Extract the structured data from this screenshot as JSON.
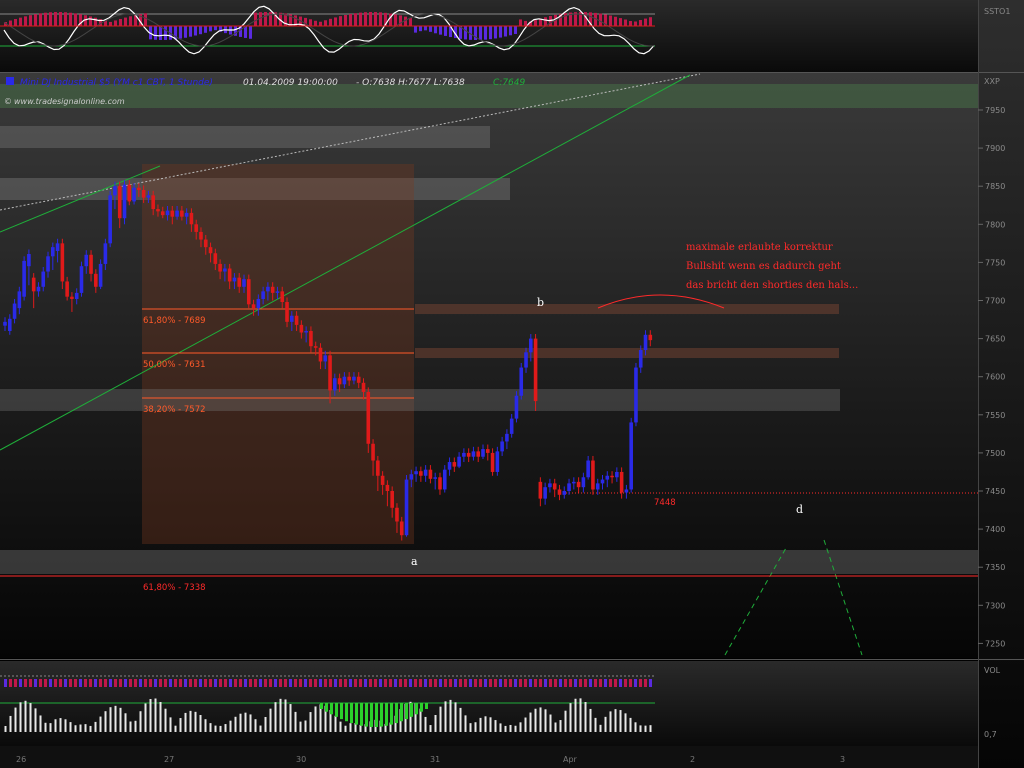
{
  "colors": {
    "bull": "#2a2ae8",
    "bear": "#e01a1a",
    "fib": "#ff5a2a",
    "annot": "#ff2a2a",
    "trend": "#1fae3a",
    "text": "#dddddd"
  },
  "header": {
    "title": "Mini DJ Industrial $5 (YM c1 CBT, 1 Stunde)",
    "datetime": "01.04.2009 19:00:00",
    "values": "- O:7638 H:7677 L:7638",
    "close": "C:7649",
    "website": "www.tradesignalonline.com"
  },
  "indicator_top": {
    "label": "SSTO1"
  },
  "indicator_bottom": {
    "label": "VOL",
    "ticks": [
      "0,7"
    ]
  },
  "price_axis": {
    "label": "XXP",
    "ticks": [
      "7950",
      "7900",
      "7850",
      "7800",
      "7750",
      "7700",
      "7650",
      "7600",
      "7550",
      "7500",
      "7450",
      "7400",
      "7350",
      "7300",
      "7250"
    ]
  },
  "chart_data": {
    "type": "candlestick",
    "x_ticks": [
      "26",
      "27",
      "30",
      "31",
      "Apr",
      "2",
      "3"
    ],
    "ylim": [
      7225,
      7975
    ],
    "candles": [
      [
        0,
        7667,
        7672,
        7660
      ],
      [
        1,
        7660,
        7676,
        7655
      ],
      [
        2,
        7676,
        7696,
        7670
      ],
      [
        3,
        7690,
        7712,
        7682
      ],
      [
        4,
        7705,
        7752,
        7700
      ],
      [
        5,
        7745,
        7761,
        7720
      ],
      [
        6,
        7730,
        7712,
        7690
      ],
      [
        7,
        7712,
        7718,
        7705
      ],
      [
        8,
        7718,
        7738,
        7712
      ],
      [
        9,
        7738,
        7758,
        7730
      ],
      [
        10,
        7758,
        7770,
        7740
      ],
      [
        11,
        7765,
        7775,
        7750
      ],
      [
        12,
        7775,
        7725,
        7715
      ],
      [
        13,
        7725,
        7705,
        7700
      ],
      [
        14,
        7705,
        7702,
        7685
      ],
      [
        15,
        7702,
        7710,
        7695
      ],
      [
        16,
        7710,
        7745,
        7705
      ],
      [
        17,
        7745,
        7760,
        7735
      ],
      [
        18,
        7760,
        7735,
        7725
      ],
      [
        19,
        7735,
        7718,
        7710
      ],
      [
        20,
        7718,
        7748,
        7715
      ],
      [
        21,
        7748,
        7775,
        7740
      ],
      [
        22,
        7775,
        7838,
        7770
      ],
      [
        23,
        7838,
        7850,
        7820
      ],
      [
        24,
        7850,
        7808,
        7795
      ],
      [
        25,
        7808,
        7852,
        7800
      ],
      [
        26,
        7852,
        7830,
        7825
      ],
      [
        27,
        7830,
        7848,
        7826
      ],
      [
        28,
        7848,
        7845,
        7836
      ],
      [
        29,
        7845,
        7835,
        7828
      ],
      [
        30,
        7835,
        7838,
        7828
      ],
      [
        31,
        7838,
        7820,
        7812
      ],
      [
        32,
        7820,
        7817,
        7810
      ],
      [
        33,
        7817,
        7812,
        7808
      ],
      [
        34,
        7812,
        7818,
        7805
      ],
      [
        35,
        7818,
        7810,
        7800
      ],
      [
        36,
        7810,
        7818,
        7806
      ],
      [
        37,
        7818,
        7810,
        7805
      ],
      [
        38,
        7810,
        7815,
        7800
      ],
      [
        39,
        7815,
        7800,
        7790
      ],
      [
        40,
        7800,
        7790,
        7780
      ],
      [
        41,
        7790,
        7780,
        7770
      ],
      [
        42,
        7780,
        7770,
        7760
      ],
      [
        43,
        7770,
        7762,
        7750
      ],
      [
        44,
        7762,
        7748,
        7740
      ],
      [
        45,
        7748,
        7738,
        7728
      ],
      [
        46,
        7738,
        7742,
        7725
      ],
      [
        47,
        7742,
        7725,
        7715
      ],
      [
        48,
        7725,
        7730,
        7715
      ],
      [
        49,
        7730,
        7718,
        7710
      ],
      [
        50,
        7718,
        7728,
        7710
      ],
      [
        51,
        7728,
        7695,
        7690
      ],
      [
        52,
        7695,
        7690,
        7680
      ],
      [
        53,
        7690,
        7702,
        7680
      ],
      [
        54,
        7702,
        7712,
        7695
      ],
      [
        55,
        7712,
        7718,
        7700
      ],
      [
        56,
        7718,
        7710,
        7700
      ],
      [
        57,
        7710,
        7712,
        7702
      ],
      [
        58,
        7712,
        7698,
        7690
      ],
      [
        59,
        7698,
        7672,
        7665
      ],
      [
        60,
        7672,
        7680,
        7660
      ],
      [
        61,
        7680,
        7668,
        7660
      ],
      [
        62,
        7668,
        7658,
        7650
      ],
      [
        63,
        7658,
        7660,
        7645
      ],
      [
        64,
        7660,
        7640,
        7632
      ],
      [
        65,
        7640,
        7638,
        7628
      ],
      [
        66,
        7638,
        7620,
        7610
      ],
      [
        67,
        7620,
        7628,
        7610
      ],
      [
        68,
        7628,
        7582,
        7565
      ],
      [
        69,
        7582,
        7598,
        7575
      ],
      [
        70,
        7598,
        7590,
        7580
      ],
      [
        71,
        7590,
        7600,
        7585
      ],
      [
        72,
        7600,
        7595,
        7588
      ],
      [
        73,
        7595,
        7600,
        7590
      ],
      [
        74,
        7600,
        7592,
        7585
      ],
      [
        75,
        7592,
        7580,
        7570
      ],
      [
        76,
        7580,
        7512,
        7500
      ],
      [
        77,
        7512,
        7490,
        7470
      ],
      [
        78,
        7490,
        7470,
        7450
      ],
      [
        79,
        7470,
        7458,
        7445
      ],
      [
        80,
        7458,
        7450,
        7430
      ],
      [
        81,
        7450,
        7428,
        7415
      ],
      [
        82,
        7428,
        7410,
        7395
      ],
      [
        83,
        7410,
        7392,
        7385
      ],
      [
        84,
        7392,
        7465,
        7390
      ],
      [
        85,
        7465,
        7472,
        7455
      ],
      [
        86,
        7472,
        7476,
        7462
      ],
      [
        87,
        7476,
        7470,
        7462
      ],
      [
        88,
        7470,
        7478,
        7462
      ],
      [
        89,
        7478,
        7466,
        7460
      ],
      [
        90,
        7466,
        7468,
        7452
      ],
      [
        91,
        7468,
        7452,
        7445
      ],
      [
        92,
        7452,
        7478,
        7448
      ],
      [
        93,
        7478,
        7488,
        7470
      ],
      [
        94,
        7488,
        7482,
        7475
      ],
      [
        95,
        7482,
        7495,
        7480
      ],
      [
        96,
        7495,
        7500,
        7488
      ],
      [
        97,
        7500,
        7495,
        7488
      ],
      [
        98,
        7495,
        7502,
        7490
      ],
      [
        99,
        7502,
        7495,
        7488
      ],
      [
        100,
        7495,
        7505,
        7492
      ],
      [
        101,
        7505,
        7500,
        7490
      ],
      [
        102,
        7500,
        7475,
        7470
      ],
      [
        103,
        7475,
        7502,
        7470
      ],
      [
        104,
        7502,
        7515,
        7496
      ],
      [
        105,
        7515,
        7525,
        7505
      ],
      [
        106,
        7525,
        7545,
        7520
      ],
      [
        107,
        7545,
        7575,
        7540
      ],
      [
        108,
        7575,
        7612,
        7570
      ],
      [
        109,
        7612,
        7632,
        7605
      ],
      [
        110,
        7632,
        7650,
        7620
      ],
      [
        111,
        7650,
        7568,
        7555
      ],
      [
        112,
        7462,
        7440,
        7430
      ],
      [
        113,
        7440,
        7455,
        7432
      ],
      [
        114,
        7455,
        7460,
        7448
      ],
      [
        115,
        7460,
        7452,
        7442
      ],
      [
        116,
        7452,
        7445,
        7438
      ],
      [
        117,
        7445,
        7450,
        7440
      ],
      [
        118,
        7450,
        7460,
        7445
      ],
      [
        119,
        7460,
        7462,
        7452
      ],
      [
        120,
        7462,
        7455,
        7448
      ],
      [
        121,
        7455,
        7468,
        7448
      ],
      [
        122,
        7468,
        7490,
        7465
      ],
      [
        123,
        7490,
        7452,
        7445
      ],
      [
        124,
        7452,
        7460,
        7445
      ],
      [
        125,
        7460,
        7465,
        7452
      ],
      [
        126,
        7465,
        7470,
        7455
      ],
      [
        127,
        7470,
        7468,
        7460
      ],
      [
        128,
        7468,
        7475,
        7462
      ],
      [
        129,
        7475,
        7448,
        7440
      ],
      [
        130,
        7448,
        7452,
        7440
      ],
      [
        131,
        7452,
        7540,
        7448
      ],
      [
        132,
        7540,
        7612,
        7535
      ],
      [
        133,
        7612,
        7635,
        7605
      ],
      [
        134,
        7635,
        7655,
        7628
      ],
      [
        135,
        7655,
        7648,
        7640
      ]
    ],
    "fibonacci": [
      {
        "label": "61,80% - 7689",
        "value": 7689
      },
      {
        "label": "50,00% - 7631",
        "value": 7631
      },
      {
        "label": "38,20% - 7572",
        "value": 7572
      },
      {
        "label": "61,80% - 7338",
        "value": 7338
      }
    ],
    "horizontal_line": {
      "label": "7448",
      "value": 7448
    },
    "wave_labels": [
      "a",
      "b",
      "d"
    ],
    "annotation": [
      "maximale erlaubte korrektur",
      "Bullshit wenn es dadurch geht",
      "das bricht den shorties den hals..."
    ]
  }
}
